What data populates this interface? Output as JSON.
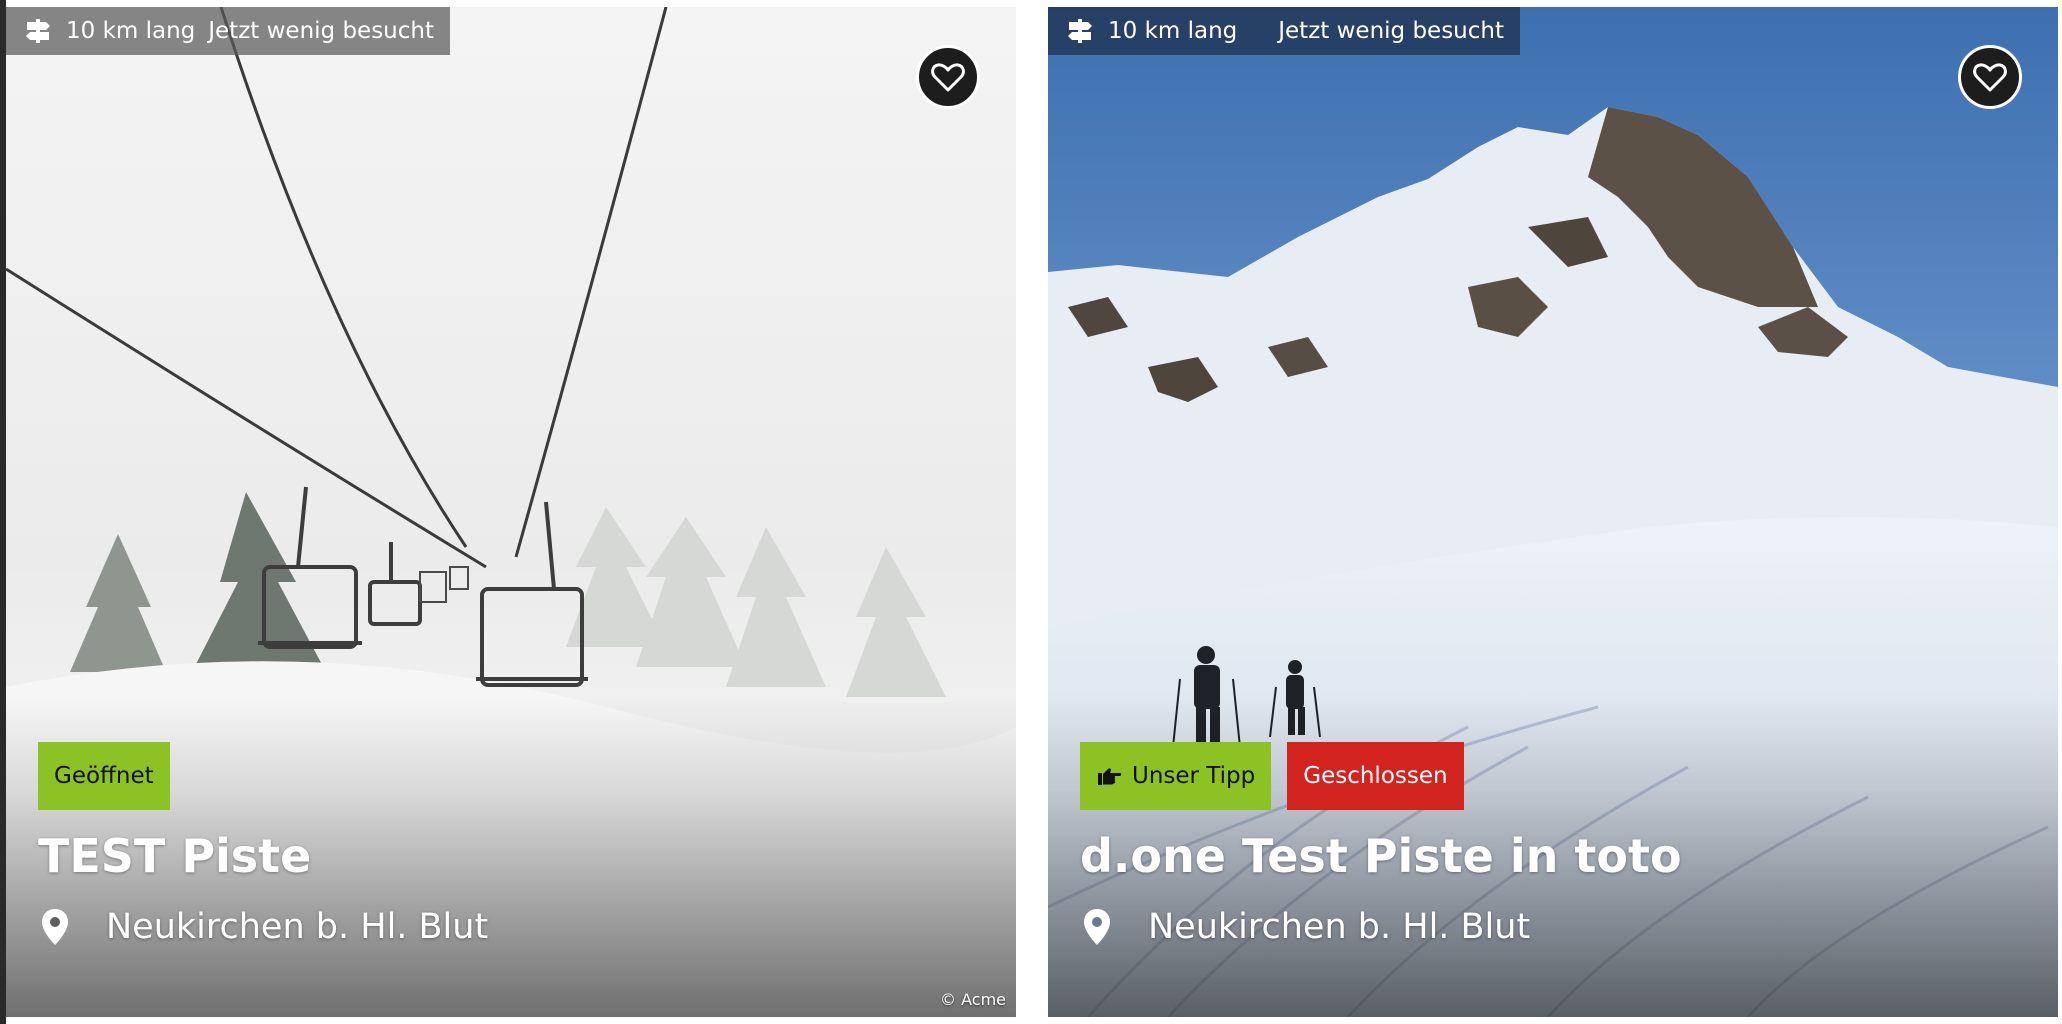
{
  "cards": [
    {
      "length": "10 km lang",
      "visitors": "Jetzt wenig besucht",
      "badges": [
        {
          "label": "Geöffnet",
          "color": "#8dc224",
          "icon": ""
        }
      ],
      "title": "TEST Piste",
      "location": "Neukirchen b. Hl. Blut",
      "copyright": "© Acme",
      "icons": {
        "meta": "signpost-icon",
        "favorite": "heart-icon",
        "location": "map-pin-icon"
      }
    },
    {
      "length": "10 km lang",
      "visitors": "Jetzt wenig besucht",
      "badges": [
        {
          "label": "Unser Tipp",
          "color": "#8dc224",
          "icon": "pointing-hand-icon"
        },
        {
          "label": "Geschlossen",
          "color": "#d2231f",
          "icon": ""
        }
      ],
      "title": "d.one Test Piste in toto",
      "location": "Neukirchen b. Hl. Blut",
      "icons": {
        "meta": "signpost-icon",
        "favorite": "heart-icon",
        "location": "map-pin-icon"
      }
    }
  ]
}
